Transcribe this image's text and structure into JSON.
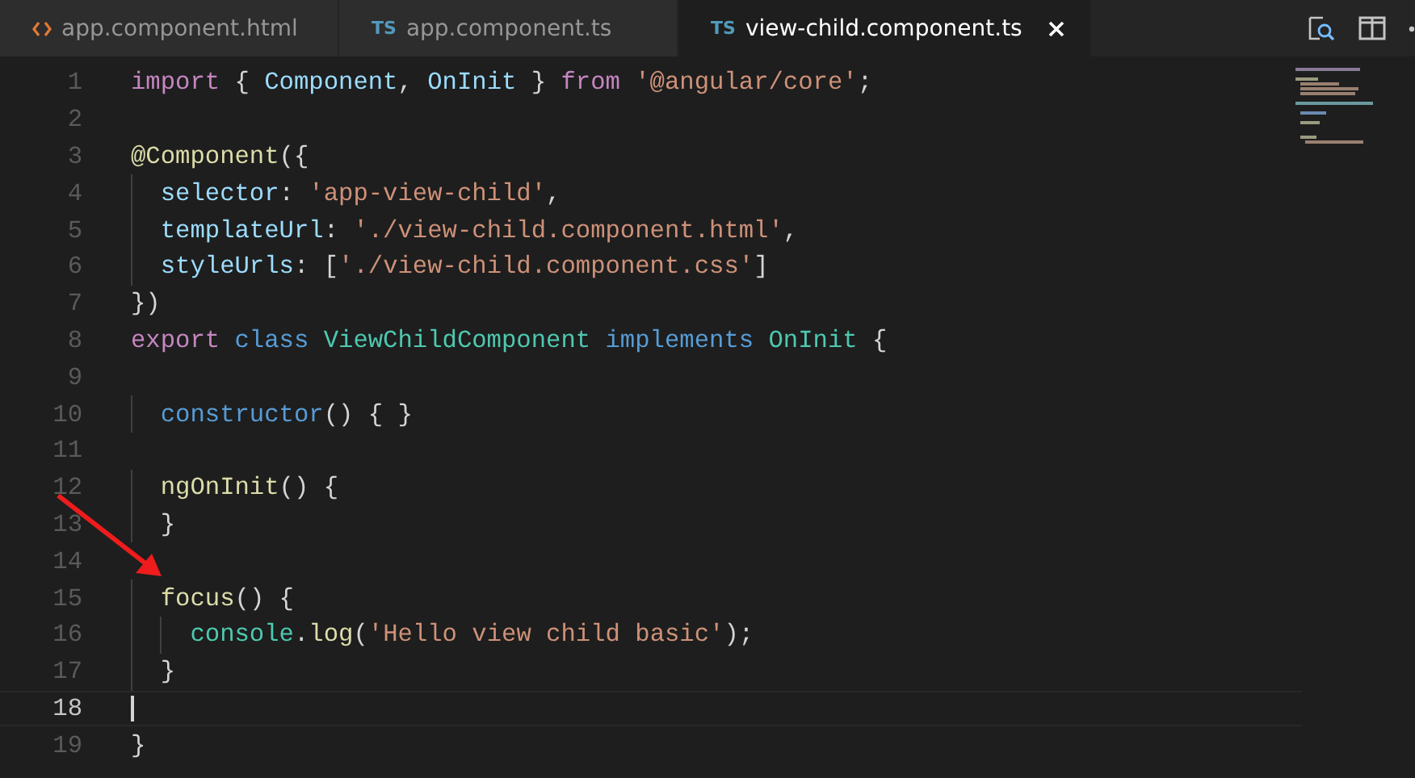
{
  "tabs": [
    {
      "kind": "html",
      "label": "app.component.html",
      "selected": false
    },
    {
      "kind": "ts",
      "badge": "TS",
      "label": "app.component.ts",
      "selected": false
    },
    {
      "kind": "ts",
      "badge": "TS",
      "label": "view-child.component.ts",
      "selected": true
    }
  ],
  "editor": {
    "lines": [
      {
        "number": "1",
        "current": false,
        "tokens": [
          {
            "kind": "keyword",
            "text": "import"
          },
          {
            "kind": "plain",
            "text": " { "
          },
          {
            "kind": "property",
            "text": "Component"
          },
          {
            "kind": "plain",
            "text": ", "
          },
          {
            "kind": "property",
            "text": "OnInit"
          },
          {
            "kind": "plain",
            "text": " } "
          },
          {
            "kind": "keyword",
            "text": "from"
          },
          {
            "kind": "string",
            "text": " '@angular/core'"
          },
          {
            "kind": "plain",
            "text": ";"
          }
        ]
      },
      {
        "number": "2",
        "current": false
      },
      {
        "number": "3",
        "current": false,
        "tokens": [
          {
            "kind": "function",
            "text": "@Component"
          },
          {
            "kind": "plain",
            "text": "({"
          }
        ]
      },
      {
        "number": "4",
        "current": false,
        "tokens": [
          {
            "kind": "property",
            "text": "  selector"
          },
          {
            "kind": "plain",
            "text": ": "
          },
          {
            "kind": "string",
            "text": "'app-view-child'"
          },
          {
            "kind": "plain",
            "text": ","
          }
        ]
      },
      {
        "number": "5",
        "current": false,
        "tokens": [
          {
            "kind": "property",
            "text": "  templateUrl"
          },
          {
            "kind": "plain",
            "text": ": "
          },
          {
            "kind": "string",
            "text": "'./view-child.component.html'"
          },
          {
            "kind": "plain",
            "text": ","
          }
        ]
      },
      {
        "number": "6",
        "current": false,
        "tokens": [
          {
            "kind": "property",
            "text": "  styleUrls"
          },
          {
            "kind": "plain",
            "text": ": ["
          },
          {
            "kind": "string",
            "text": "'./view-child.component.css'"
          },
          {
            "kind": "plain",
            "text": "]"
          }
        ]
      },
      {
        "number": "7",
        "current": false,
        "tokens": [
          {
            "kind": "plain",
            "text": "})"
          }
        ]
      },
      {
        "number": "8",
        "current": false,
        "tokens": [
          {
            "kind": "keyword",
            "text": "export"
          },
          {
            "kind": "storage",
            "text": " class"
          },
          {
            "kind": "type",
            "text": " ViewChildComponent"
          },
          {
            "kind": "storage",
            "text": " implements"
          },
          {
            "kind": "type",
            "text": " OnInit"
          },
          {
            "kind": "plain",
            "text": " {"
          }
        ]
      },
      {
        "number": "9",
        "current": false
      },
      {
        "number": "10",
        "current": false,
        "tokens": [
          {
            "kind": "storage",
            "text": "  constructor"
          },
          {
            "kind": "plain",
            "text": "() { }"
          }
        ]
      },
      {
        "number": "11",
        "current": false
      },
      {
        "number": "12",
        "current": false,
        "tokens": [
          {
            "kind": "function",
            "text": "  ngOnInit"
          },
          {
            "kind": "plain",
            "text": "() {"
          }
        ]
      },
      {
        "number": "13",
        "current": false,
        "tokens": [
          {
            "kind": "plain",
            "text": "  }"
          }
        ]
      },
      {
        "number": "14",
        "current": false
      },
      {
        "number": "15",
        "current": false,
        "tokens": [
          {
            "kind": "function",
            "text": "  focus"
          },
          {
            "kind": "plain",
            "text": "() {"
          }
        ]
      },
      {
        "number": "16",
        "current": false,
        "tokens": [
          {
            "kind": "type",
            "text": "    console"
          },
          {
            "kind": "plain",
            "text": "."
          },
          {
            "kind": "function",
            "text": "log"
          },
          {
            "kind": "plain",
            "text": "("
          },
          {
            "kind": "string",
            "text": "'Hello view child basic'"
          },
          {
            "kind": "plain",
            "text": ");"
          }
        ]
      },
      {
        "number": "17",
        "current": false,
        "tokens": [
          {
            "kind": "plain",
            "text": "  }"
          }
        ]
      },
      {
        "number": "18",
        "current": true
      },
      {
        "number": "19",
        "current": false,
        "tokens": [
          {
            "kind": "plain",
            "text": "}"
          }
        ]
      }
    ]
  }
}
